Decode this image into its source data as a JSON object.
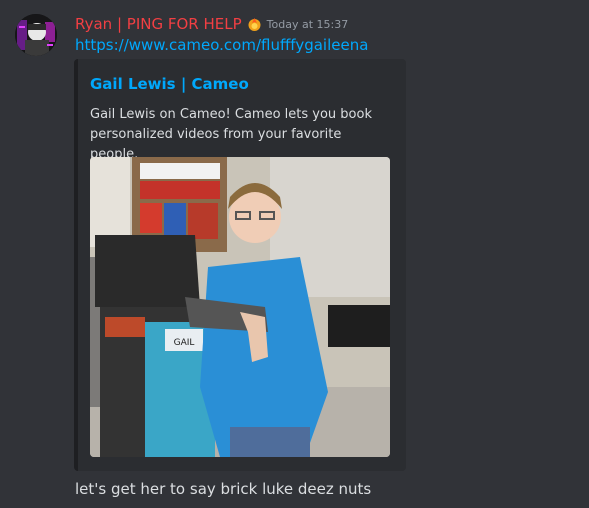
{
  "message": {
    "author": "Ryan | PING FOR HELP",
    "role_icon": "fire-badge-icon",
    "timestamp": "Today at 15:37",
    "link": "https://www.cameo.com/flufffygaileena",
    "content": "let's get her to say brick luke deez nuts"
  },
  "embed": {
    "title": "Gail Lewis | Cameo",
    "description": "Gail Lewis on Cameo! Cameo lets you book personalized videos from your favorite people.",
    "image_alt": "photo",
    "name_tag": "GAIL"
  },
  "colors": {
    "background": "#313338",
    "embed_bg": "#2b2d31",
    "username": "#f23f43",
    "link": "#00a8fc",
    "vest": "#2a8fd6"
  }
}
